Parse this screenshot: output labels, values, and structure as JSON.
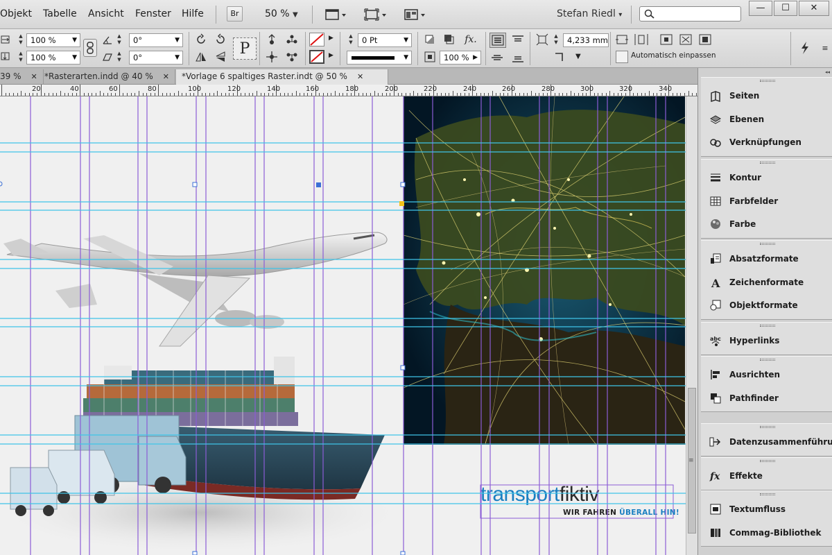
{
  "menu": [
    "Objekt",
    "Tabelle",
    "Ansicht",
    "Fenster",
    "Hilfe"
  ],
  "menubar": {
    "bridge_label": "Br",
    "zoom": "50 %",
    "user": "Stefan Riedl",
    "search_placeholder": ""
  },
  "window_buttons": {
    "minimize": "—",
    "restore": "☐",
    "close": "✕"
  },
  "control": {
    "scale_x": "100 %",
    "scale_y": "100 %",
    "rotation": "0°",
    "shear": "0°",
    "text_label": "P",
    "stroke_weight": "0 Pt",
    "opacity": "100 %",
    "fit_value": "4,233 mm",
    "auto_fit": "Automatisch einpassen",
    "effects_label": "fx."
  },
  "tabs": [
    {
      "label": "39 %"
    },
    {
      "label": "*Rasterarten.indd @ 40 %"
    },
    {
      "label": "*Vorlage 6 spaltiges Raster.indt @ 50 %"
    }
  ],
  "ruler": [
    "20",
    "40",
    "60",
    "80",
    "100",
    "120",
    "140",
    "160",
    "180",
    "200",
    "220",
    "240",
    "260",
    "280",
    "300",
    "320",
    "340"
  ],
  "panel": {
    "groups": [
      {
        "items": [
          {
            "label": "Seiten",
            "icon": "pages-icon"
          },
          {
            "label": "Ebenen",
            "icon": "layers-icon"
          },
          {
            "label": "Verknüpfungen",
            "icon": "links-icon"
          }
        ]
      },
      {
        "items": [
          {
            "label": "Kontur",
            "icon": "stroke-icon"
          },
          {
            "label": "Farbfelder",
            "icon": "swatches-icon"
          },
          {
            "label": "Farbe",
            "icon": "color-icon"
          }
        ]
      },
      {
        "items": [
          {
            "label": "Absatzformate",
            "icon": "paragraph-styles-icon"
          },
          {
            "label": "Zeichenformate",
            "icon": "character-styles-icon"
          },
          {
            "label": "Objektformate",
            "icon": "object-styles-icon"
          }
        ]
      },
      {
        "items": [
          {
            "label": "Hyperlinks",
            "icon": "hyperlinks-icon"
          }
        ]
      },
      {
        "items": [
          {
            "label": "Ausrichten",
            "icon": "align-icon"
          },
          {
            "label": "Pathfinder",
            "icon": "pathfinder-icon"
          }
        ]
      },
      {
        "items": [
          {
            "label": "Datenzusammenführung",
            "icon": "data-merge-icon"
          }
        ]
      },
      {
        "items": [
          {
            "label": "Effekte",
            "icon": "effects-icon"
          }
        ]
      },
      {
        "items": [
          {
            "label": "Textumfluss",
            "icon": "text-wrap-icon"
          },
          {
            "label": "Commag-Bibliothek",
            "icon": "library-icon"
          }
        ]
      }
    ]
  },
  "document": {
    "logo_part1": "transport",
    "logo_part2": "fiktiv",
    "slogan_part1": "WIR FAHREN ",
    "slogan_part2": "ÜBERALL HIN!"
  },
  "colors": {
    "column_guide": "#8b5cd6",
    "baseline_guide": "#3fc4e8",
    "logo_blue": "#1a7fc1",
    "map_bg": "#06233a",
    "map_land": "#2e3c19",
    "map_light": "#e9d35c"
  }
}
